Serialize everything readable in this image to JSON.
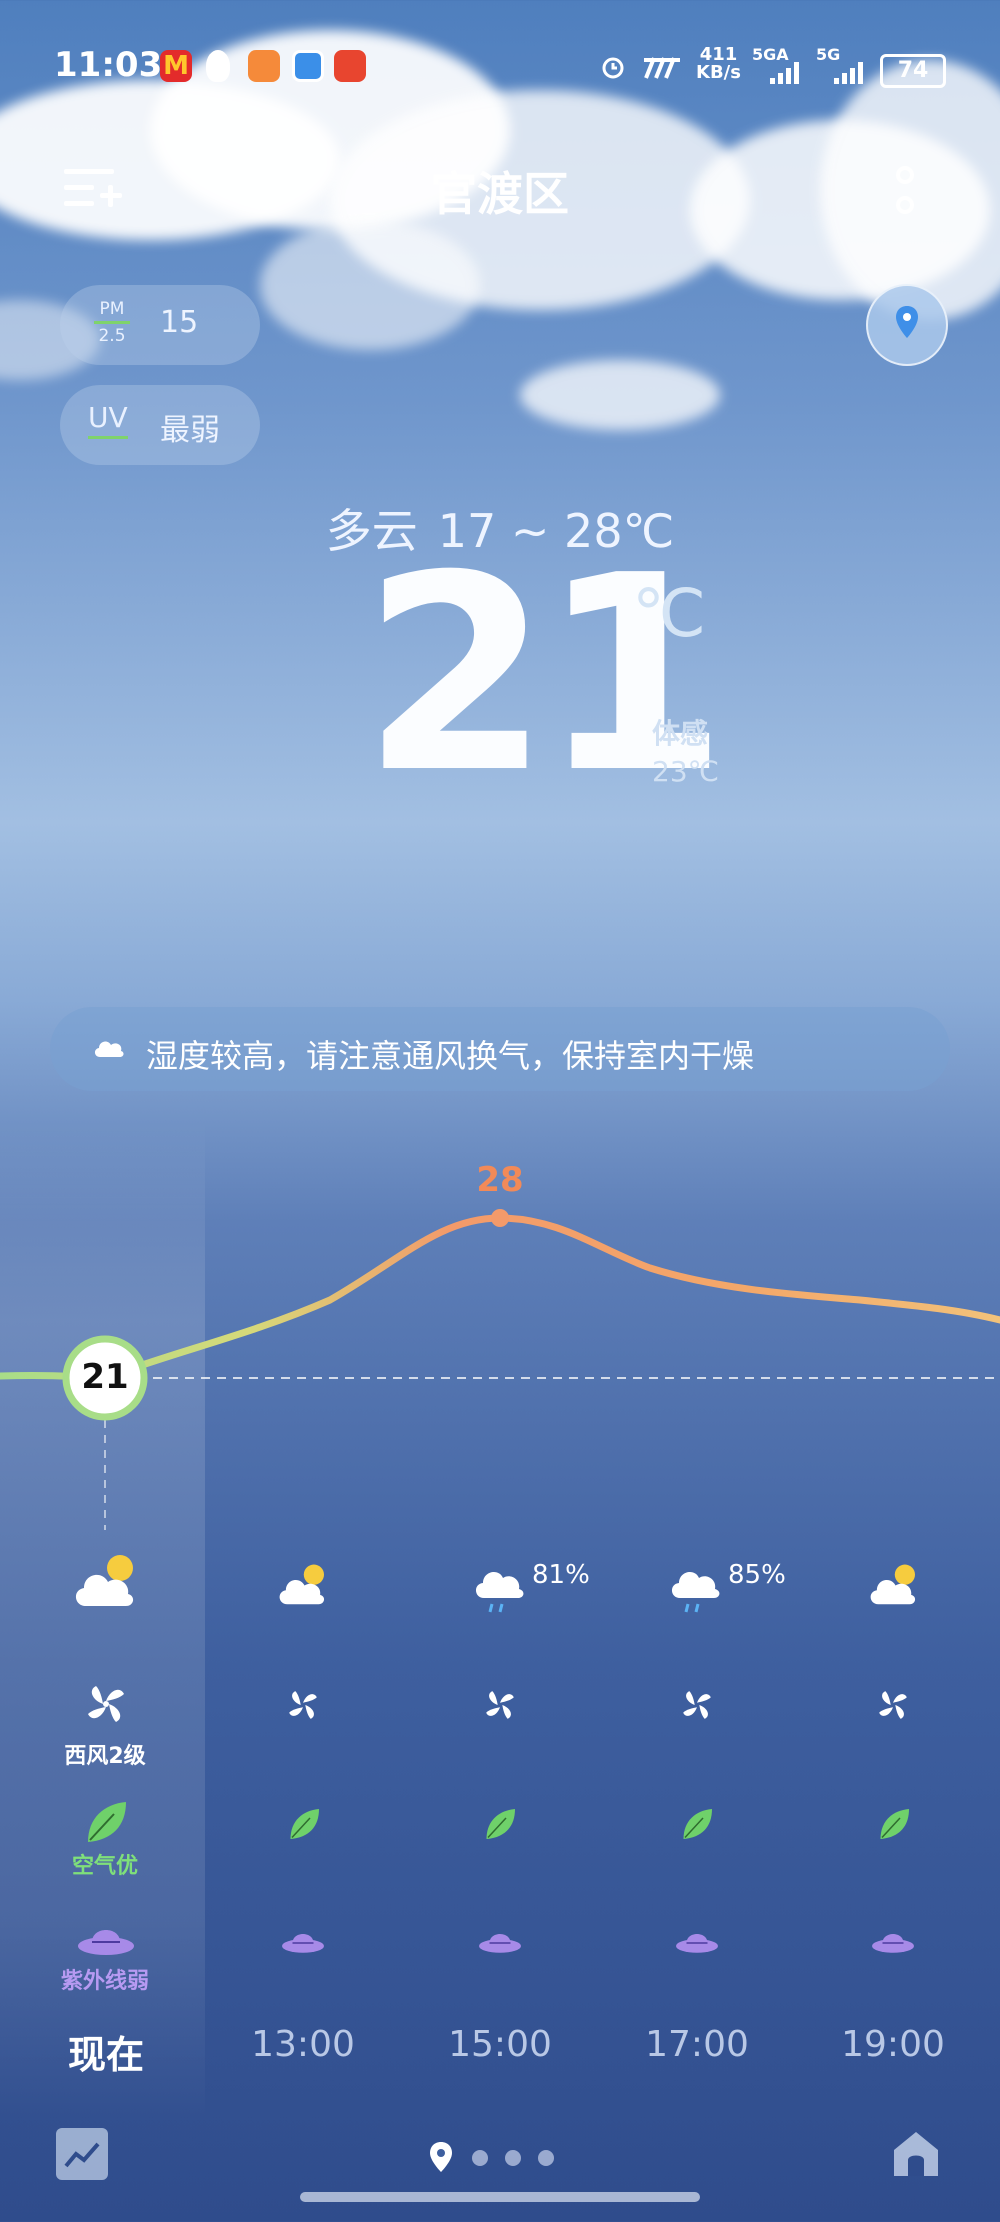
{
  "status_bar": {
    "time": "11:03",
    "net_speed_value": "411",
    "net_speed_unit": "KB/s",
    "sim1": "5GA",
    "sim2": "5G",
    "battery": "74"
  },
  "header": {
    "city": "官渡区"
  },
  "air": {
    "pm_label_top": "PM",
    "pm_label_bottom": "2.5",
    "pm_value": "15",
    "uv_label": "UV",
    "uv_value": "最弱"
  },
  "current": {
    "condition": "多云",
    "range": "17 ~ 28℃",
    "temp": "21",
    "unit": "℃",
    "feels_label": "体感",
    "feels_value": "23℃"
  },
  "tip": {
    "text": "湿度较高，请注意通风换气，保持室内干燥"
  },
  "hourly": {
    "current_temp": "21",
    "max_temp": "28",
    "now": {
      "time": "现在",
      "wind": "西风2级",
      "air": "空气优",
      "uv": "紫外线弱"
    },
    "columns": [
      {
        "time": "13:00",
        "icon": "partly-cloudy-icon",
        "precip": ""
      },
      {
        "time": "15:00",
        "icon": "rain-cloud-icon",
        "precip": "81%"
      },
      {
        "time": "17:00",
        "icon": "rain-cloud-icon",
        "precip": "85%"
      },
      {
        "time": "19:00",
        "icon": "partly-cloudy-icon",
        "precip": ""
      }
    ]
  },
  "colors": {
    "curve_start": "#a8dd88",
    "curve_peak": "#f39a6a",
    "leaf": "#6fd16a",
    "uv_purple": "#a78ae8",
    "max_label": "#f28a58"
  }
}
